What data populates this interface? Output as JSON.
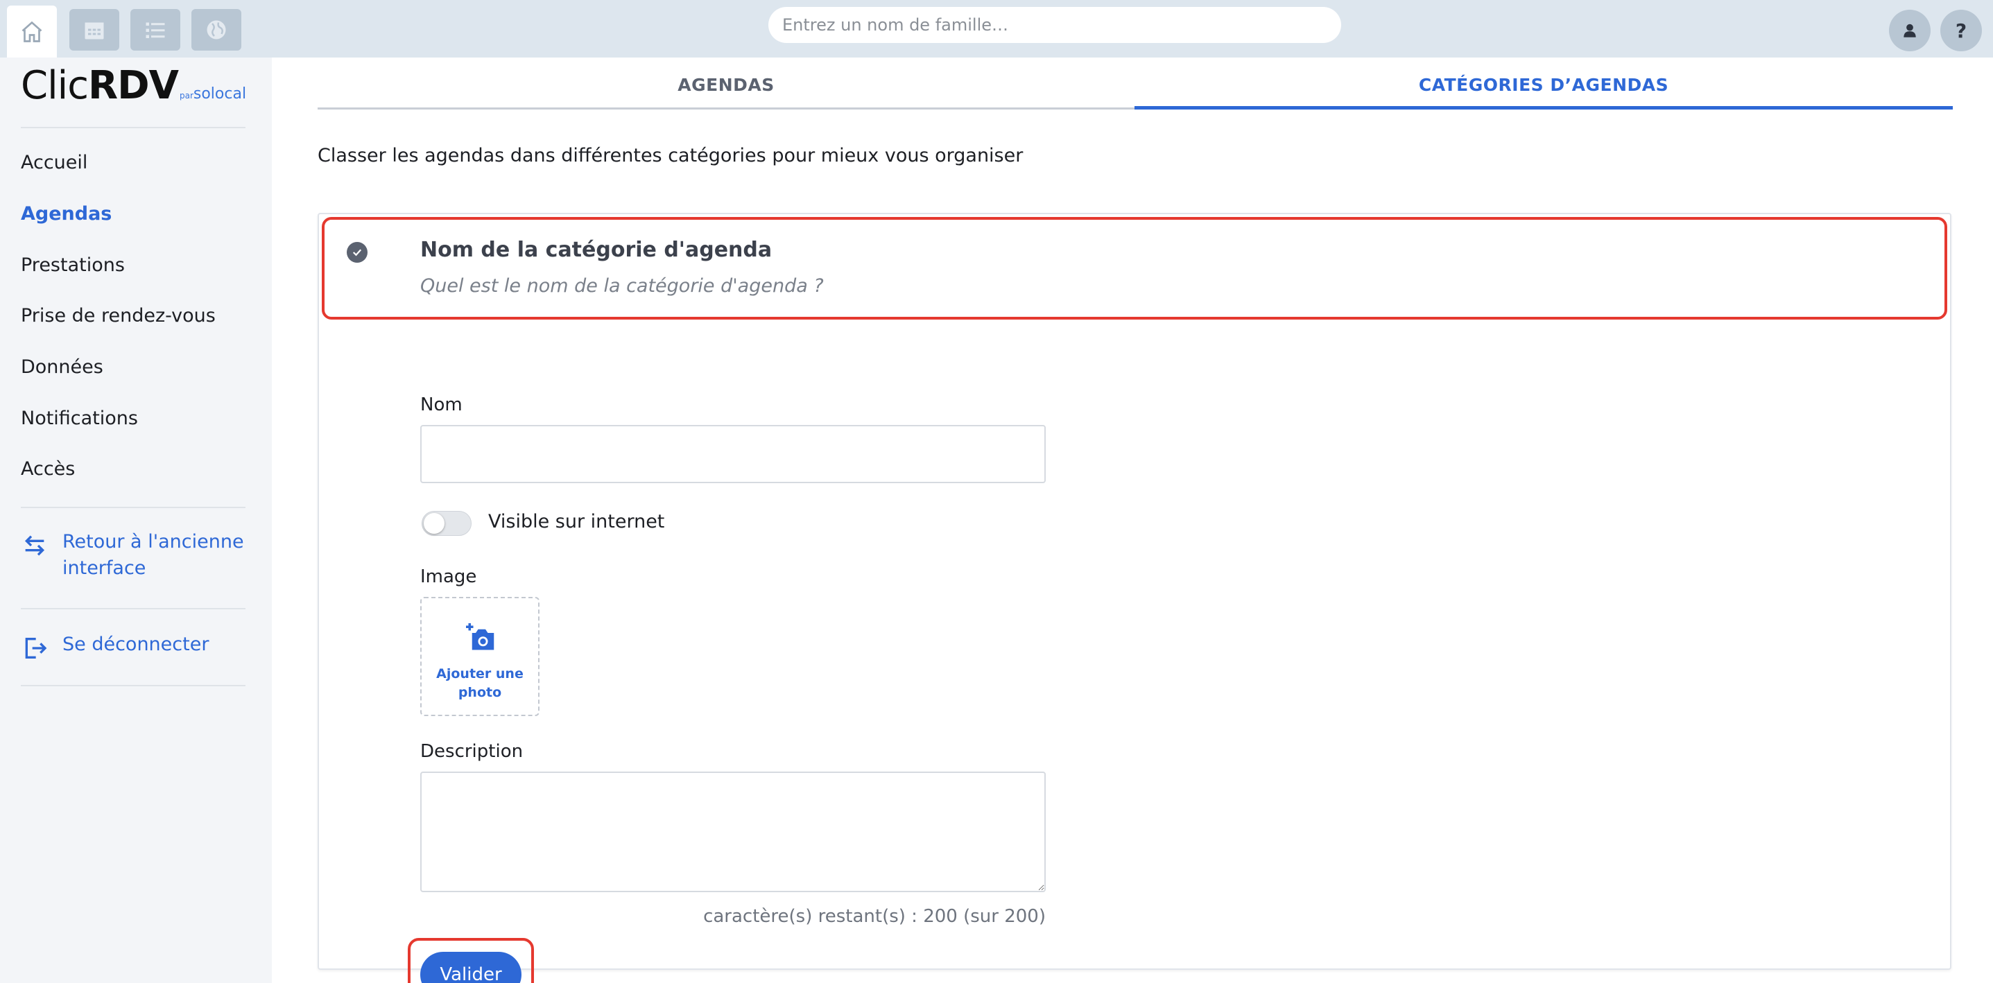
{
  "topbar": {
    "search_placeholder": "Entrez un nom de famille…",
    "help_label": "?",
    "icons": [
      "home-icon",
      "calendar-icon",
      "list-icon",
      "globe-icon",
      "user-icon"
    ]
  },
  "logo": {
    "brand_light": "Clic",
    "brand_bold": "RDV",
    "par": "par",
    "solocal": "solocal"
  },
  "sidebar": {
    "items": [
      {
        "label": "Accueil",
        "active": false
      },
      {
        "label": "Agendas",
        "active": true
      },
      {
        "label": "Prestations",
        "active": false
      },
      {
        "label": "Prise de rendez-vous",
        "active": false
      },
      {
        "label": "Données",
        "active": false
      },
      {
        "label": "Notifications",
        "active": false
      },
      {
        "label": "Accès",
        "active": false
      }
    ],
    "back_link_line1": "Retour à l'ancienne",
    "back_link_line2": "interface",
    "logout_label": "Se déconnecter"
  },
  "tabs": [
    {
      "label": "AGENDAS",
      "active": false
    },
    {
      "label": "CATÉGORIES D’AGENDAS",
      "active": true
    }
  ],
  "intro": "Classer les agendas dans différentes catégories pour mieux vous organiser",
  "form": {
    "title": "Nom de la catégorie d'agenda",
    "subtitle": "Quel est le nom de la catégorie d'agenda ?",
    "nom_label": "Nom",
    "nom_value": "",
    "visible_label": "Visible sur internet",
    "visible_on": false,
    "image_label": "Image",
    "photo_line1": "Ajouter une",
    "photo_line2": "photo",
    "description_label": "Description",
    "description_value": "",
    "counter": "caractère(s) restant(s) : 200 (sur 200)",
    "submit_label": "Valider"
  },
  "colors": {
    "accent": "#2e68d6",
    "highlight": "#e5392f",
    "topbar": "#dde6ee"
  }
}
